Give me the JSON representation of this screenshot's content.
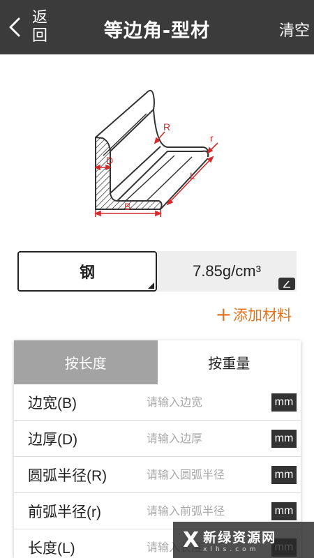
{
  "header": {
    "back_label": "返回",
    "title": "等边角-型材",
    "clear_label": "清空"
  },
  "diagram": {
    "labels": {
      "R": "R",
      "r": "r",
      "D": "D",
      "L": "L",
      "B": "B"
    },
    "accent_color": "#d42a2a"
  },
  "material": {
    "name": "钢",
    "density": "7.85g/cm³"
  },
  "add_material_label": "添加材料",
  "add_material_icon": "+",
  "tabs": [
    {
      "label": "按长度",
      "active": true
    },
    {
      "label": "按重量",
      "active": false
    }
  ],
  "fields": [
    {
      "label": "边宽(B)",
      "placeholder": "请输入边宽",
      "unit": "mm"
    },
    {
      "label": "边厚(D)",
      "placeholder": "请输入边厚",
      "unit": "mm"
    },
    {
      "label": "圆弧半径(R)",
      "placeholder": "请输入圆弧半径",
      "unit": "mm"
    },
    {
      "label": "前弧半径(r)",
      "placeholder": "请输入前弧半径",
      "unit": "mm"
    },
    {
      "label": "长度(L)",
      "placeholder": "请输入长度",
      "unit": "mm"
    }
  ],
  "watermark": {
    "mark": "X",
    "text_cn": "新绿资源网",
    "text_en": "xlhs.com"
  },
  "colors": {
    "topbar": "#3b3b3b",
    "accent_orange": "#e8731c",
    "active_tab": "#a3a3a3"
  }
}
